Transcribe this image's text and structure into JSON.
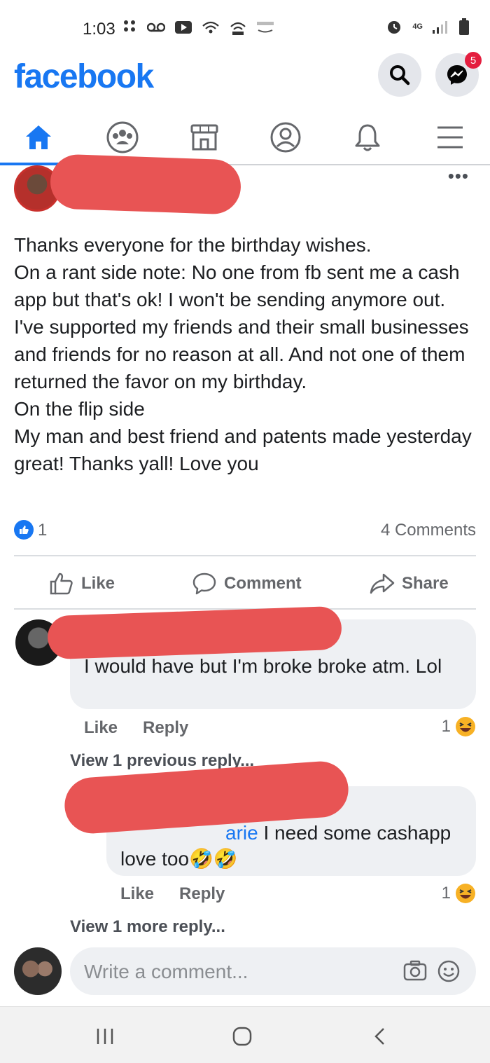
{
  "status_bar": {
    "time": "1:03",
    "network_label": "4G"
  },
  "header": {
    "logo": "facebook",
    "messenger_badge": "5"
  },
  "tabs": [
    {
      "name": "home-icon",
      "active": true
    },
    {
      "name": "groups-icon",
      "active": false
    },
    {
      "name": "marketplace-icon",
      "active": false
    },
    {
      "name": "profile-icon",
      "active": false
    },
    {
      "name": "notifications-icon",
      "active": false
    },
    {
      "name": "menu-icon",
      "active": false
    }
  ],
  "post": {
    "lines": [
      "Thanks everyone for the birthday wishes.",
      "On a rant side note: No one from fb sent me a cash app but that's ok! I won't be sending anymore out. I've supported my friends and their small businesses and friends for no reason at all. And not one of them returned the favor on my birthday.",
      "On the flip side",
      "My man and best friend and patents made yesterday great! Thanks yall! Love you"
    ],
    "like_count": "1",
    "comment_count": "4 Comments"
  },
  "actions": {
    "like": "Like",
    "comment": "Comment",
    "share": "Share"
  },
  "comments": [
    {
      "text": "I would have but I'm broke broke atm. Lol",
      "like_label": "Like",
      "reply_label": "Reply",
      "reaction_count": "1",
      "view_replies": "View 1 previous reply..."
    },
    {
      "mention_suffix": "arie",
      "text": "I need some cashapp love too🤣🤣",
      "like_label": "Like",
      "reply_label": "Reply",
      "reaction_count": "1",
      "view_replies": "View 1 more reply..."
    }
  ],
  "composer": {
    "placeholder": "Write a comment..."
  },
  "colors": {
    "brand": "#1877f2",
    "redaction": "#e85454",
    "bubble": "#eef0f3"
  }
}
